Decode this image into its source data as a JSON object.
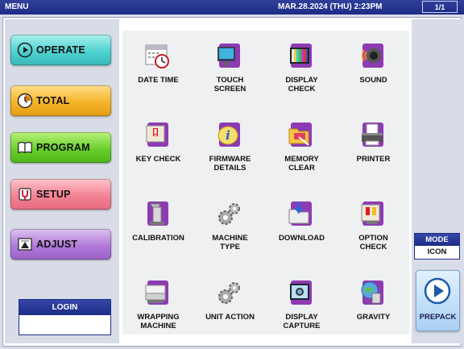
{
  "topbar": {
    "title": "MENU",
    "datetime": "MAR.28.2024 (THU)  2:23PM",
    "page": "1/1"
  },
  "nav": [
    {
      "label": "OPERATE",
      "icon": "play-circle-icon"
    },
    {
      "label": "TOTAL",
      "icon": "clock-icon"
    },
    {
      "label": "PROGRAM",
      "icon": "book-icon"
    },
    {
      "label": "SETUP",
      "icon": "wrench-icon"
    },
    {
      "label": "ADJUST",
      "icon": "slider-icon"
    }
  ],
  "login": {
    "label": "LOGIN",
    "value": ""
  },
  "grid": [
    {
      "line1": "DATE TIME",
      "line2": "",
      "icon": "calendar-clock-icon"
    },
    {
      "line1": "TOUCH",
      "line2": "SCREEN",
      "icon": "monitor-icon"
    },
    {
      "line1": "DISPLAY",
      "line2": "CHECK",
      "icon": "color-bars-icon"
    },
    {
      "line1": "SOUND",
      "line2": "",
      "icon": "speaker-icon"
    },
    {
      "line1": "KEY CHECK",
      "line2": "",
      "icon": "key-warning-icon"
    },
    {
      "line1": "FIRMWARE",
      "line2": "DETAILS",
      "icon": "info-icon"
    },
    {
      "line1": "MEMORY",
      "line2": "CLEAR",
      "icon": "folder-delete-icon"
    },
    {
      "line1": "PRINTER",
      "line2": "",
      "icon": "printer-icon"
    },
    {
      "line1": "CALIBRATION",
      "line2": "",
      "icon": "weight-icon"
    },
    {
      "line1": "MACHINE",
      "line2": "TYPE",
      "icon": "gears-icon"
    },
    {
      "line1": "DOWNLOAD",
      "line2": "",
      "icon": "folder-download-icon"
    },
    {
      "line1": "OPTION",
      "line2": "CHECK",
      "icon": "option-warning-icon"
    },
    {
      "line1": "WRAPPING",
      "line2": "MACHINE",
      "icon": "wrapping-machine-icon"
    },
    {
      "line1": "UNIT ACTION",
      "line2": "",
      "icon": "gears-icon"
    },
    {
      "line1": "DISPLAY",
      "line2": "CAPTURE",
      "icon": "camera-icon"
    },
    {
      "line1": "GRAVITY",
      "line2": "",
      "icon": "globe-weight-icon"
    }
  ],
  "mode": {
    "label": "MODE",
    "value": "ICON"
  },
  "prepack": {
    "label": "PREPACK",
    "icon": "play-circle-icon"
  },
  "colors": {
    "topbar": "#1d2c86",
    "tile": "#8e3bb3",
    "accent": "#2f3f9a"
  }
}
